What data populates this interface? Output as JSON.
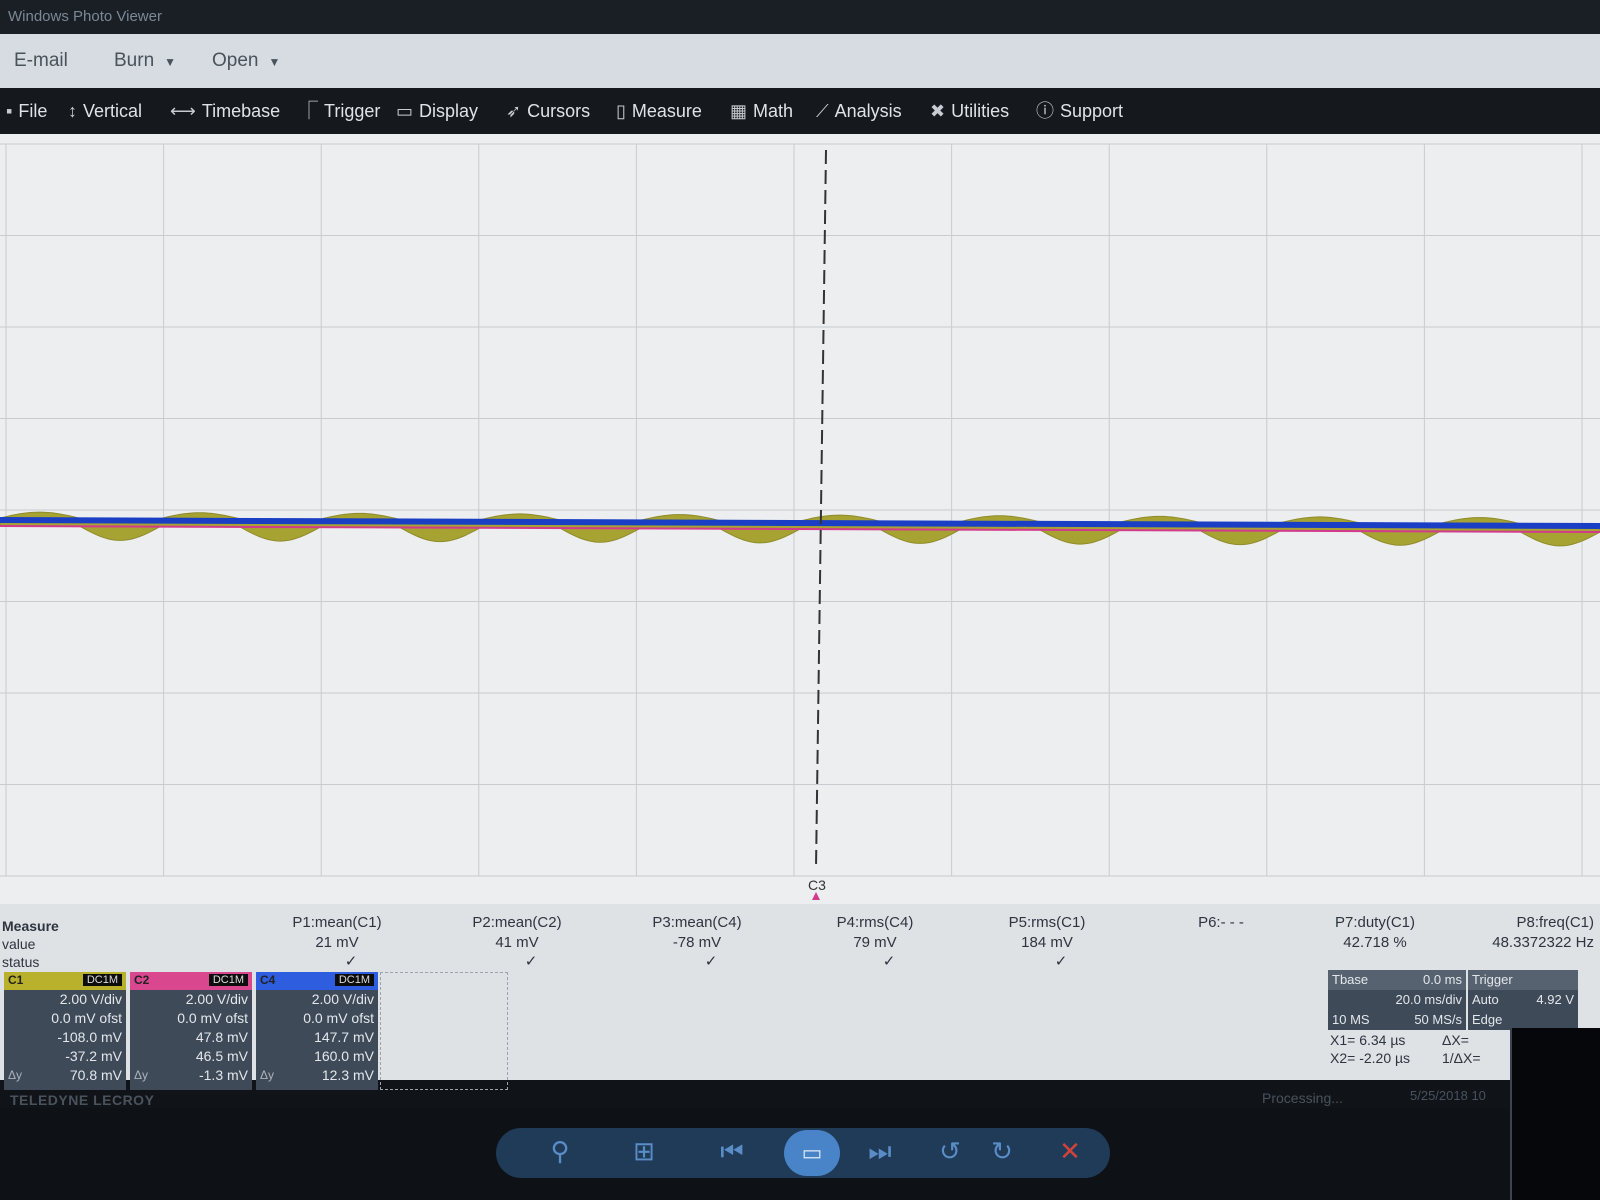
{
  "window": {
    "title": "Windows Photo Viewer"
  },
  "photo_toolbar": {
    "email": "E-mail",
    "burn": "Burn",
    "open": "Open"
  },
  "scope_menu": {
    "file": "File",
    "vertical": "Vertical",
    "timebase": "Timebase",
    "trigger": "Trigger",
    "display": "Display",
    "cursors": "Cursors",
    "measure": "Measure",
    "math": "Math",
    "analysis": "Analysis",
    "utilities": "Utilities",
    "support": "Support"
  },
  "waveform": {
    "channel_marker": "C3",
    "colors": {
      "c1": "#a7a332",
      "c2": "#d23a8c",
      "c4": "#1a3fc4",
      "grid": "#c8ccd0",
      "cursor": "#333333"
    }
  },
  "measure": {
    "labels": {
      "title": "Measure",
      "value": "value",
      "status": "status"
    },
    "params": [
      {
        "name": "P1:mean(C1)",
        "value": "21 mV",
        "status": "✓"
      },
      {
        "name": "P2:mean(C2)",
        "value": "41 mV",
        "status": "✓"
      },
      {
        "name": "P3:mean(C4)",
        "value": "-78 mV",
        "status": "✓"
      },
      {
        "name": "P4:rms(C4)",
        "value": "79 mV",
        "status": "✓"
      },
      {
        "name": "P5:rms(C1)",
        "value": "184 mV",
        "status": "✓"
      },
      {
        "name": "P6:- - -",
        "value": "",
        "status": ""
      },
      {
        "name": "P7:duty(C1)",
        "value": "42.718 %",
        "status": ""
      },
      {
        "name": "P8:freq(C1)",
        "value": "48.3372322 Hz",
        "status": ""
      }
    ]
  },
  "channels": [
    {
      "tag": "C1",
      "coupling": "DC1M",
      "color": "#b9b12c",
      "vdiv": "2.00 V/div",
      "ofst": "0.0 mV ofst",
      "v1": "-108.0 mV",
      "v2": "-37.2 mV",
      "dy_label": "Δy",
      "dy": "70.8 mV"
    },
    {
      "tag": "C2",
      "coupling": "DC1M",
      "color": "#d9488f",
      "vdiv": "2.00 V/div",
      "ofst": "0.0 mV ofst",
      "v1": "47.8 mV",
      "v2": "46.5 mV",
      "dy_label": "Δy",
      "dy": "-1.3 mV"
    },
    {
      "tag": "C4",
      "coupling": "DC1M",
      "color": "#2e5de0",
      "vdiv": "2.00 V/div",
      "ofst": "0.0 mV ofst",
      "v1": "147.7 mV",
      "v2": "160.0 mV",
      "dy_label": "Δy",
      "dy": "12.3 mV"
    }
  ],
  "timebase": {
    "label": "Tbase",
    "delay": "0.0 ms",
    "tdiv": "20.0 ms/div",
    "samples": "10 MS",
    "rate": "50 MS/s"
  },
  "trigger": {
    "label": "Trigger",
    "mode": "Auto",
    "level": "4.92 V",
    "type": "Edge"
  },
  "cursors": {
    "x1": "X1= 6.34 µs",
    "x2": "X2= -2.20 µs",
    "dx": "ΔX=",
    "inv_dx": "1/ΔX="
  },
  "footer": {
    "brand": "TELEDYNE LECROY",
    "status": "Processing...",
    "date": "5/25/2018 10"
  }
}
